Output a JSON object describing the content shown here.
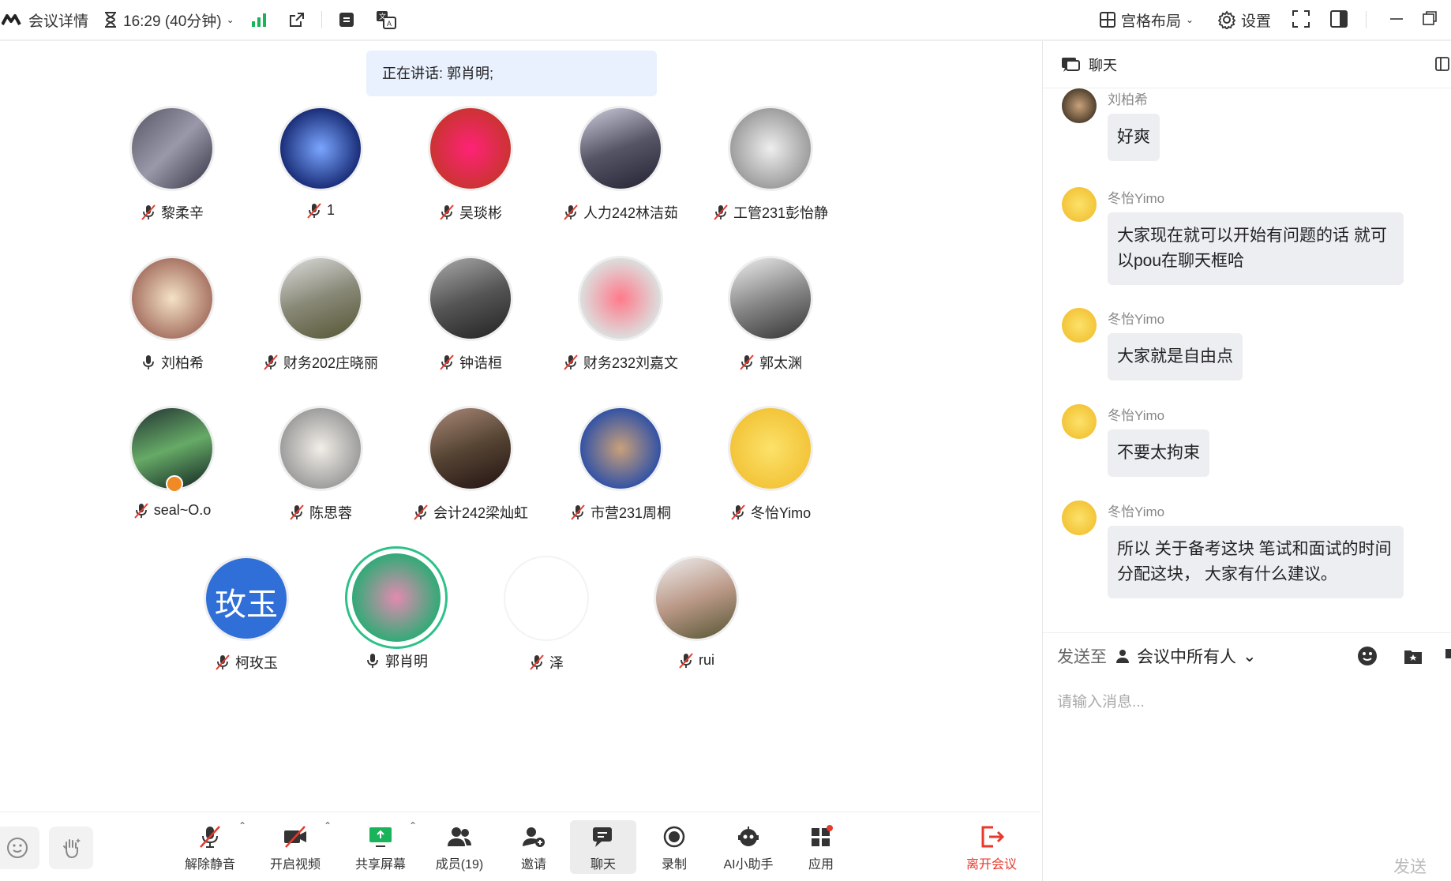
{
  "topbar": {
    "app": "会议详情",
    "time": "16:29 (40分钟)",
    "layout": "宫格布局",
    "settings": "设置"
  },
  "speaking": "正在讲话: 郭肖明;",
  "participants": [
    {
      "name": "黎柔辛",
      "mic": "muted"
    },
    {
      "name": "1",
      "mic": "muted"
    },
    {
      "name": "吴琰彬",
      "mic": "muted"
    },
    {
      "name": "人力242林洁茹",
      "mic": "muted"
    },
    {
      "name": "工管231彭怡静",
      "mic": "muted"
    },
    {
      "name": "刘柏希",
      "mic": "on"
    },
    {
      "name": "财务202庄晓丽",
      "mic": "muted"
    },
    {
      "name": "钟诰桓",
      "mic": "muted"
    },
    {
      "name": "财务232刘嘉文",
      "mic": "muted"
    },
    {
      "name": "郭太渊",
      "mic": "muted"
    },
    {
      "name": "seal~O.o",
      "mic": "muted"
    },
    {
      "name": "陈思蓉",
      "mic": "muted"
    },
    {
      "name": "会计242梁灿虹",
      "mic": "muted"
    },
    {
      "name": "市营231周桐",
      "mic": "muted"
    },
    {
      "name": "冬怡Yimo",
      "mic": "muted"
    },
    {
      "name": "柯玫玉",
      "mic": "muted",
      "avatar_text": "玫玉"
    },
    {
      "name": "郭肖明",
      "mic": "on"
    },
    {
      "name": "泽",
      "mic": "muted"
    },
    {
      "name": "rui",
      "mic": "muted"
    }
  ],
  "chat": {
    "title": "聊天",
    "messages": [
      {
        "sender": "刘柏希",
        "text": "好爽"
      },
      {
        "sender": "冬怡Yimo",
        "text": "大家现在就可以开始有问题的话 就可以pou在聊天框哈"
      },
      {
        "sender": "冬怡Yimo",
        "text": "大家就是自由点"
      },
      {
        "sender": "冬怡Yimo",
        "text": "不要太拘束"
      },
      {
        "sender": "冬怡Yimo",
        "text": "所以 关于备考这块 笔试和面试的时间分配这块， 大家有什么建议。"
      }
    ],
    "send_to_label": "发送至",
    "send_to_value": "会议中所有人",
    "placeholder": "请输入消息...",
    "send": "发送"
  },
  "toolbar": {
    "unmute": "解除静音",
    "video": "开启视频",
    "share": "共享屏幕",
    "members": "成员(19)",
    "invite": "邀请",
    "chat": "聊天",
    "record": "录制",
    "ai": "AI小助手",
    "apps": "应用",
    "leave": "离开会议"
  },
  "colors": {
    "accent": "#2f6fd7",
    "leave": "#e8392d",
    "ring": "#2ec187",
    "green": "#19b35a"
  }
}
